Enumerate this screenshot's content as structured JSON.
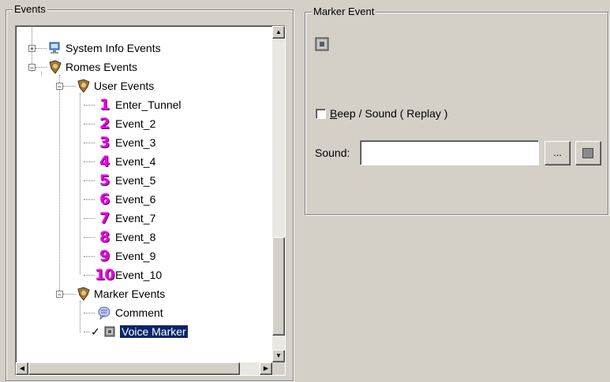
{
  "events_panel": {
    "title": "Events",
    "tree": {
      "system_info": {
        "label": "System Info Events",
        "expander": "+"
      },
      "romes": {
        "label": "Romes Events",
        "expander": "−"
      },
      "user_events": {
        "label": "User Events",
        "expander": "−"
      },
      "user_event_items": [
        {
          "num": "1",
          "label": "Enter_Tunnel"
        },
        {
          "num": "2",
          "label": "Event_2"
        },
        {
          "num": "3",
          "label": "Event_3"
        },
        {
          "num": "4",
          "label": "Event_4"
        },
        {
          "num": "5",
          "label": "Event_5"
        },
        {
          "num": "6",
          "label": "Event_6"
        },
        {
          "num": "7",
          "label": "Event_7"
        },
        {
          "num": "8",
          "label": "Event_8"
        },
        {
          "num": "9",
          "label": "Event_9"
        },
        {
          "num": "10",
          "label": "Event_10"
        }
      ],
      "marker_events": {
        "label": "Marker Events",
        "expander": "−"
      },
      "comment": {
        "label": "Comment"
      },
      "voice_marker": {
        "label": "Voice Marker",
        "check": "✓"
      }
    },
    "vscroll_position": 0.88
  },
  "marker_panel": {
    "title": "Marker Event",
    "beep_prefix": "B",
    "beep_rest": "eep / Sound ( Replay )",
    "beep_checked": false,
    "sound_label": "Sound:",
    "sound_value": "",
    "browse_label": "..."
  },
  "colors": {
    "selection": "#0a246a",
    "number_magenta": "#e800e8",
    "face": "#d4d0c8"
  }
}
